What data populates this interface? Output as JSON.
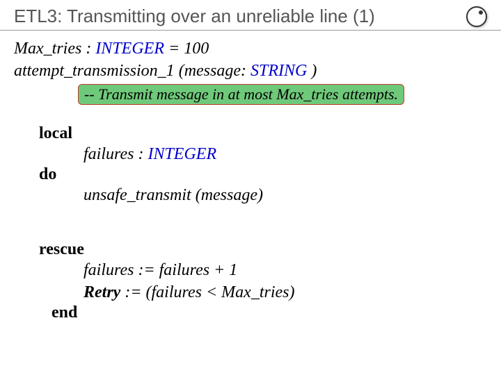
{
  "title": "ETL3: Transmitting over an unreliable line (1)",
  "decl": {
    "max_tries_name": "Max_tries",
    "max_tries_type": "INTEGER",
    "max_tries_eq": "=",
    "max_tries_val": "100",
    "proc_name": "attempt_transmission_1",
    "proc_open": " (",
    "arg_name": "message",
    "arg_colon": ": ",
    "arg_type": "STRING",
    "proc_close": " )"
  },
  "comment": {
    "prefix": "-- Transmit ",
    "msg": "message",
    "mid": " in at most ",
    "mt": "Max_tries",
    "suffix": " attempts."
  },
  "kw": {
    "local": "local",
    "do": "do",
    "rescue": "rescue",
    "end": "end",
    "retry": "Retry"
  },
  "body": {
    "failures_decl_name": "failures",
    "failures_decl_colon": " : ",
    "failures_decl_type": "INTEGER",
    "call_name": "unsafe_transmit",
    "call_open": " (",
    "call_arg": "message",
    "call_close": ")"
  },
  "rescue": {
    "line1_lhs": "failures",
    "line1_op": " := ",
    "line1_rhs1": "failures",
    "line1_plus": " + ",
    "line1_one": "1",
    "line2_op": " := (",
    "line2_lhs": "failures",
    "line2_lt": "  < ",
    "line2_rhs": "Max_tries",
    "line2_close": ")"
  }
}
